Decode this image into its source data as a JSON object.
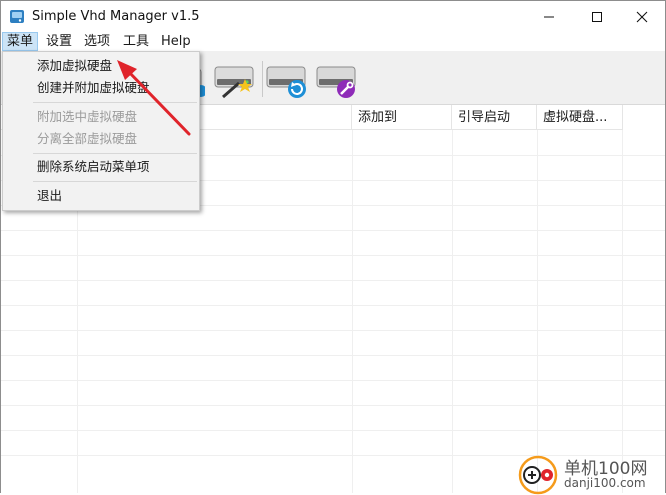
{
  "window": {
    "title": "Simple Vhd Manager v1.5"
  },
  "menubar": {
    "items": [
      "菜单",
      "设置",
      "选项",
      "工具",
      "Help"
    ]
  },
  "toolbar": {
    "buttons": [
      "add-drive",
      "attach-drive",
      "new-drive",
      "refresh-drive",
      "repair-drive"
    ]
  },
  "listview": {
    "columns": [
      "",
      "添加到",
      "引导启动",
      "虚拟硬盘..."
    ]
  },
  "dropdown": {
    "items": [
      {
        "label": "添加虚拟硬盘",
        "enabled": true
      },
      {
        "label": "创建并附加虚拟硬盘",
        "enabled": true
      },
      {
        "label": "附加选中虚拟硬盘",
        "enabled": false
      },
      {
        "label": "分离全部虚拟硬盘",
        "enabled": false
      },
      {
        "label": "删除系统启动菜单项",
        "enabled": true
      },
      {
        "label": "退出",
        "enabled": true
      }
    ]
  },
  "watermark": {
    "name": "单机100网",
    "url": "danji100.com"
  },
  "colors": {
    "accent_arrow": "#e0242b",
    "menu_highlight": "#cce4f7",
    "refresh_icon": "#1e8fd6",
    "repair_icon": "#8e2bb8"
  }
}
